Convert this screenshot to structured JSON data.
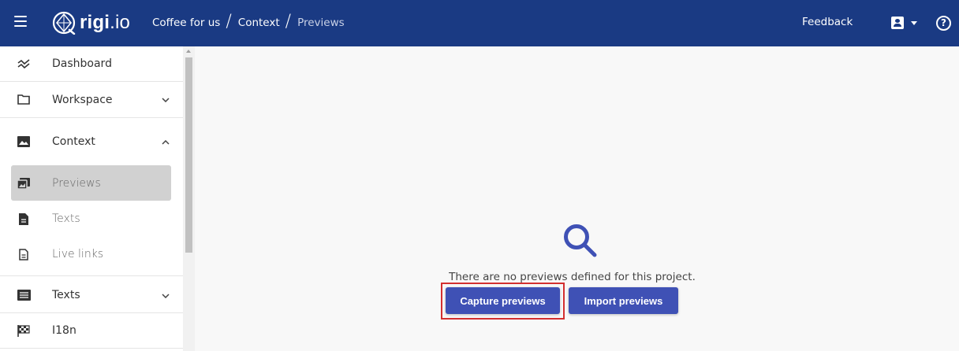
{
  "header": {
    "logo_text_bold": "rigi",
    "logo_text_suffix": ".io",
    "breadcrumb": [
      {
        "label": "Coffee for us"
      },
      {
        "label": "Context"
      },
      {
        "label": "Previews"
      }
    ],
    "feedback_label": "Feedback",
    "help_glyph": "?"
  },
  "sidebar": {
    "items": [
      {
        "label": "Dashboard",
        "icon": "trend-icon"
      },
      {
        "label": "Workspace",
        "icon": "folder-icon",
        "chevron": "down"
      },
      {
        "label": "Context",
        "icon": "image-icon",
        "chevron": "up"
      },
      {
        "label": "Previews",
        "icon": "previews-icon",
        "active": true
      },
      {
        "label": "Texts",
        "icon": "document-icon"
      },
      {
        "label": "Live links",
        "icon": "document-outline-icon"
      },
      {
        "label": "Texts",
        "icon": "list-icon",
        "chevron": "down"
      },
      {
        "label": "I18n",
        "icon": "flag-icon"
      }
    ],
    "chevron_down_glyph": "⌵",
    "chevron_up_glyph": "^"
  },
  "main": {
    "empty_message": "There are no previews defined for this project.",
    "capture_label": "Capture previews",
    "import_label": "Import previews"
  },
  "colors": {
    "header_bg": "#1a3a83",
    "button_bg": "#3f51b5",
    "highlight_border": "#d32f2f",
    "active_item_bg": "#d1d1d1"
  }
}
